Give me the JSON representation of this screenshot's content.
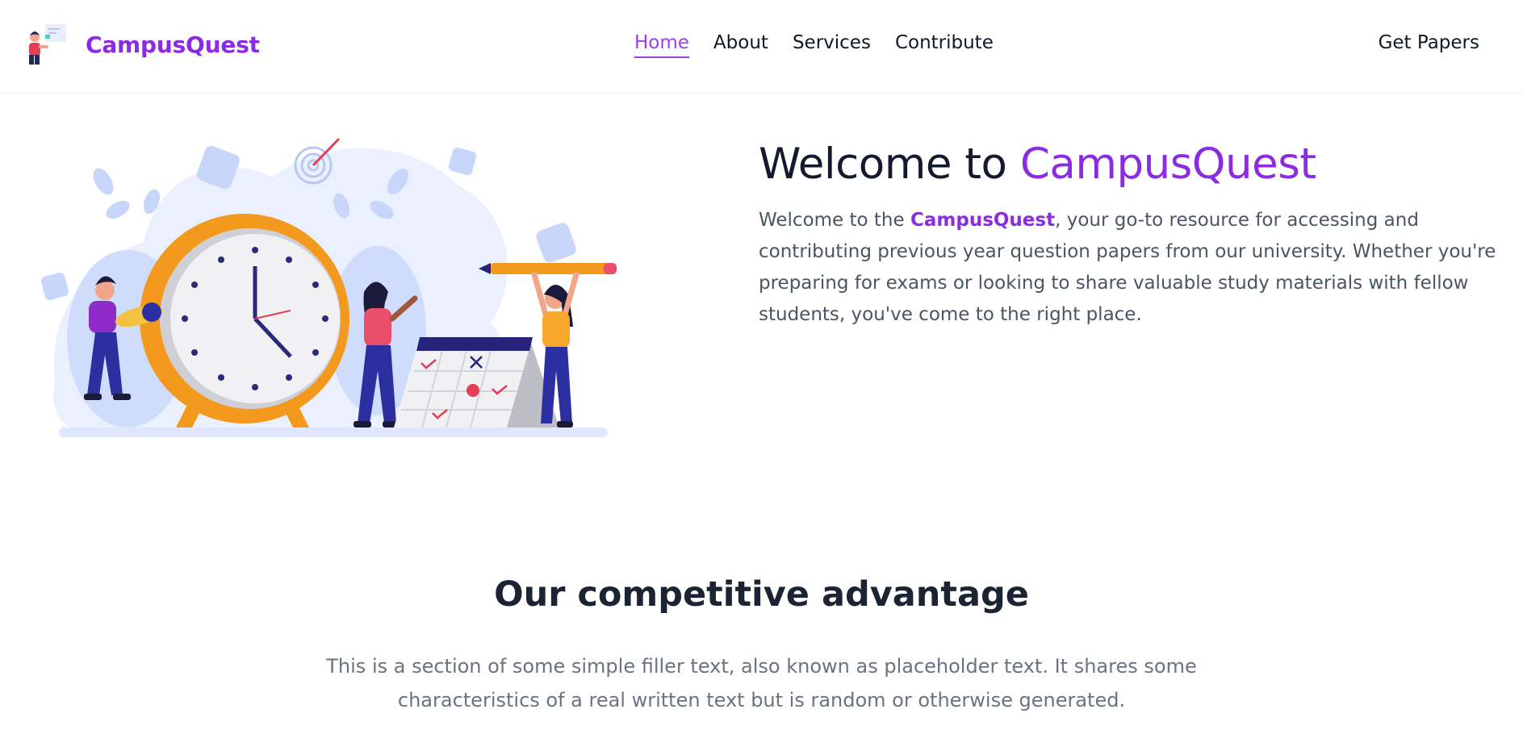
{
  "header": {
    "brand_name": "CampusQuest",
    "logo_icon": "student-with-board-icon",
    "nav": [
      {
        "label": "Home",
        "active": true
      },
      {
        "label": "About",
        "active": false
      },
      {
        "label": "Services",
        "active": false
      },
      {
        "label": "Contribute",
        "active": false
      }
    ],
    "cta_label": "Get Papers"
  },
  "hero": {
    "title_prefix": "Welcome to ",
    "title_accent": "CampusQuest",
    "desc_prefix": "Welcome to the ",
    "desc_brand": "CampusQuest",
    "desc_rest": ", your go-to resource for accessing and contributing previous year question papers from our university. Whether you're preparing for exams or looking to share valuable study materials with fellow students, you've come to the right place.",
    "illustration_icon": "students-clock-calendar-illustration"
  },
  "advantage": {
    "title": "Our competitive advantage",
    "text": "This is a section of some simple filler text, also known as placeholder text. It shares some characteristics of a real written text but is random or otherwise generated."
  },
  "colors": {
    "accent": "#8b2be2",
    "heading": "#141a2e",
    "body_text": "#4b5563",
    "muted_text": "#6b7280"
  }
}
